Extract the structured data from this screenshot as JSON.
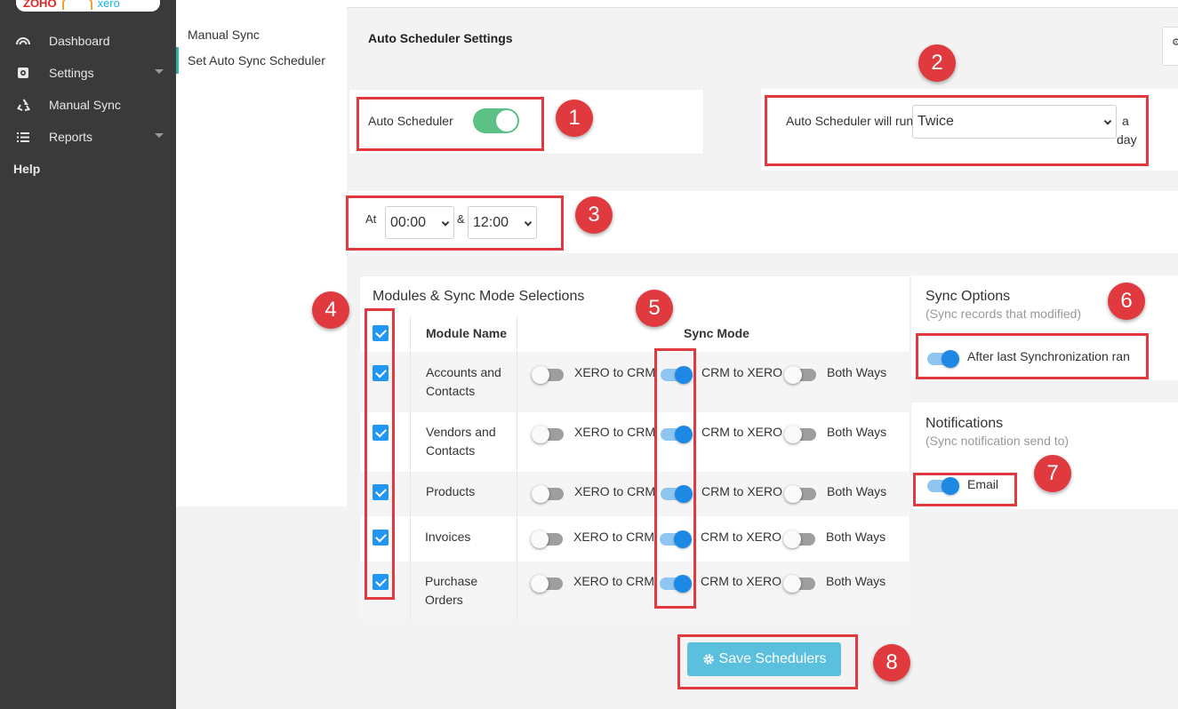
{
  "brand": {
    "logo_left": "ZOHO",
    "logo_right": "xero"
  },
  "sidebar": {
    "items": [
      {
        "label": "Dashboard",
        "icon": "dashboard-gauge-icon"
      },
      {
        "label": "Settings",
        "icon": "settings-cog-icon"
      },
      {
        "label": "Manual Sync",
        "icon": "sync-recycle-icon"
      },
      {
        "label": "Reports",
        "icon": "list-icon"
      }
    ],
    "help": "Help"
  },
  "subnav": {
    "items": [
      {
        "label": "Manual Sync",
        "active": false
      },
      {
        "label": "Set Auto Sync Scheduler",
        "active": true
      }
    ]
  },
  "page": {
    "title": "Auto Scheduler Settings"
  },
  "auto_scheduler": {
    "label": "Auto Scheduler",
    "enabled": true
  },
  "frequency": {
    "prefix": "Auto Scheduler will run",
    "value": "Twice",
    "suffix_1": "a",
    "suffix_2": "day"
  },
  "times": {
    "at_label": "At",
    "time_1": "00:00",
    "separator": "&",
    "time_2": "12:00"
  },
  "modules": {
    "title": "Modules & Sync Mode Selections",
    "col_module": "Module Name",
    "col_mode": "Sync Mode",
    "mode_labels": {
      "xero_to_crm": "XERO to CRM",
      "crm_to_xero": "CRM to XERO",
      "both": "Both Ways"
    },
    "rows": [
      {
        "name_1": "Accounts and",
        "name_2": "Contacts",
        "checked": true,
        "mode": "crm_to_xero"
      },
      {
        "name_1": "Vendors and",
        "name_2": "Contacts",
        "checked": true,
        "mode": "crm_to_xero"
      },
      {
        "name_1": "Products",
        "name_2": "",
        "checked": true,
        "mode": "crm_to_xero"
      },
      {
        "name_1": "Invoices",
        "name_2": "",
        "checked": true,
        "mode": "crm_to_xero"
      },
      {
        "name_1": "Purchase",
        "name_2": "Orders",
        "checked": true,
        "mode": "crm_to_xero"
      }
    ]
  },
  "sync_options": {
    "title": "Sync Options",
    "subtitle": "(Sync records that modified)",
    "option_label": "After last Synchronization ran",
    "enabled": true
  },
  "notifications": {
    "title": "Notifications",
    "subtitle": "(Sync notification send to)",
    "option_label": "Email",
    "enabled": true
  },
  "save_button": {
    "label": "Save Schedulers",
    "icon": "gear-icon"
  },
  "annotations": [
    "1",
    "2",
    "3",
    "4",
    "5",
    "6",
    "7",
    "8"
  ],
  "colors": {
    "annotation": "#e0393e",
    "switch_on": "#1e88e5",
    "toggle_green": "#5cc184",
    "save_button": "#5bc0de",
    "sidebar": "#3a3a3a"
  }
}
